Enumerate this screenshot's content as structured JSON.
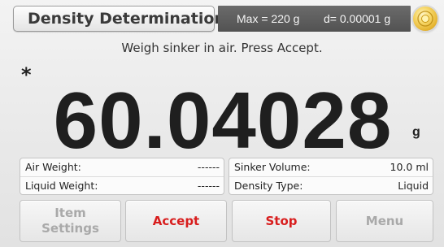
{
  "header": {
    "title": "Density Determination",
    "capacity": "Max = 220 g",
    "readability": "d= 0.00001 g",
    "status_icon": "level-bubble-icon"
  },
  "main": {
    "prompt": "Weigh sinker in air. Press Accept.",
    "stability_indicator": "*",
    "reading": "60.04028",
    "unit": "g"
  },
  "info_left": [
    {
      "label": "Air Weight:",
      "value": "------"
    },
    {
      "label": "Liquid Weight:",
      "value": "------"
    }
  ],
  "info_right": [
    {
      "label": "Sinker Volume:",
      "value": "10.0 ml"
    },
    {
      "label": "Density Type:",
      "value": "Liquid"
    }
  ],
  "buttons": {
    "item_settings_line1": "Item",
    "item_settings_line2": "Settings",
    "accept": "Accept",
    "stop": "Stop",
    "menu": "Menu"
  },
  "colors": {
    "active_button_text": "#d81d1d",
    "disabled_button_text": "#a9a9a9",
    "capacity_box_bg": "#5e5e5e",
    "status_icon": "#f0c64a"
  }
}
